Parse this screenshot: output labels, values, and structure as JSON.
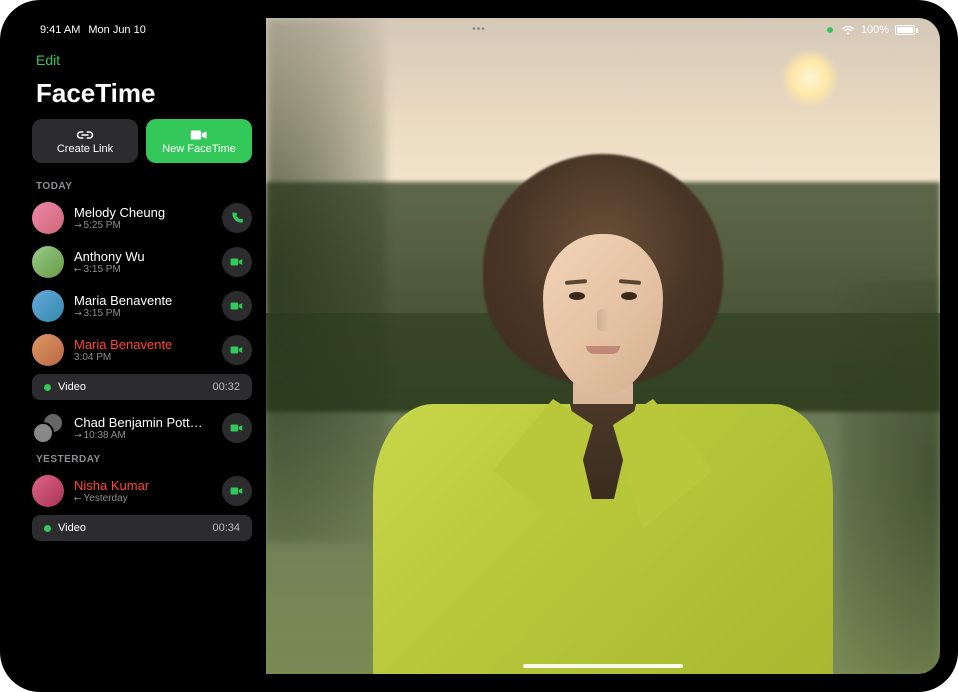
{
  "status": {
    "time": "9:41 AM",
    "date": "Mon Jun 10",
    "battery": "100%"
  },
  "sidebar": {
    "edit": "Edit",
    "title": "FaceTime",
    "createLink": "Create Link",
    "newFacetime": "New FaceTime",
    "sections": {
      "today": "Today",
      "yesterday": "Yesterday"
    }
  },
  "calls": {
    "today": [
      {
        "name": "Melody Cheung",
        "time": "5:25 PM",
        "direction": "out",
        "missed": false,
        "action": "phone"
      },
      {
        "name": "Anthony Wu",
        "time": "3:15 PM",
        "direction": "in",
        "missed": false,
        "action": "video"
      },
      {
        "name": "Maria Benavente",
        "time": "3:15 PM",
        "direction": "out",
        "missed": false,
        "action": "video"
      },
      {
        "name": "Maria Benavente",
        "time": "3:04 PM",
        "direction": "",
        "missed": true,
        "action": "video",
        "recording": {
          "label": "Video",
          "duration": "00:32"
        }
      },
      {
        "name": "Chad Benjamin Pott…",
        "time": "10:38 AM",
        "direction": "out",
        "missed": false,
        "action": "video",
        "group": true
      }
    ],
    "yesterday": [
      {
        "name": "Nisha Kumar",
        "time": "Yesterday",
        "direction": "in",
        "missed": true,
        "action": "video",
        "recording": {
          "label": "Video",
          "duration": "00:34"
        }
      }
    ]
  }
}
